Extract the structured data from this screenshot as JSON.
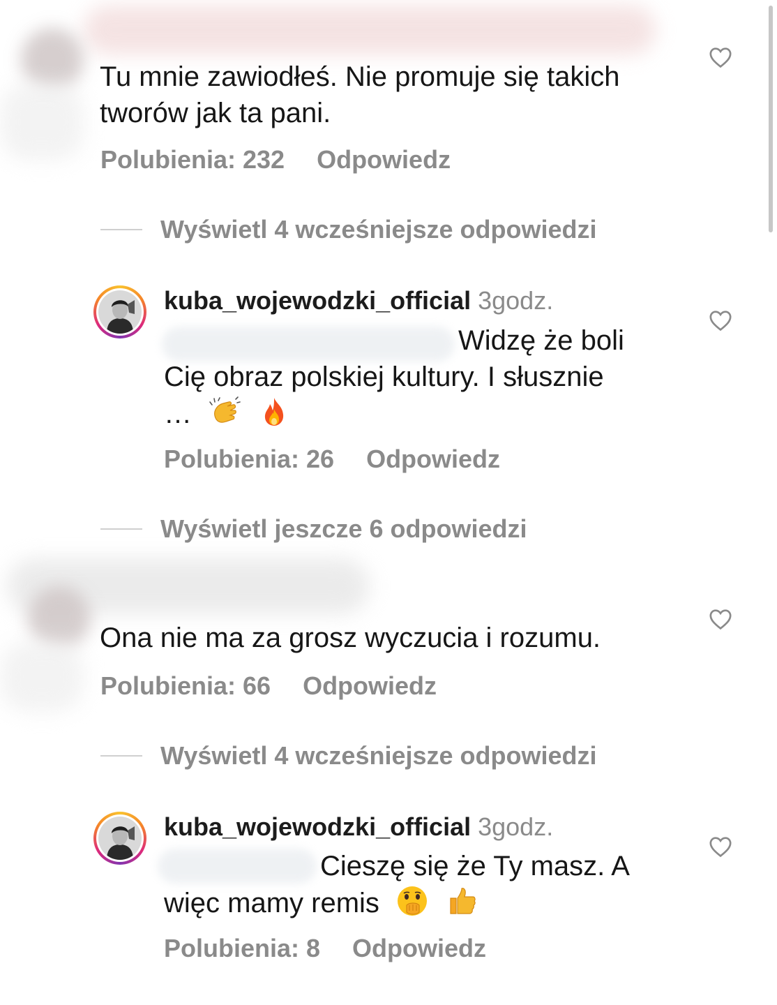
{
  "comments": [
    {
      "text": "Tu mnie zawiodłeś. Nie promuje się takich tworów jak ta pani.",
      "likes": "Polubienia: 232",
      "reply": "Odpowiedz",
      "view_replies": "Wyświetl 4 wcześniejsze odpowiedzi"
    },
    {
      "username": "kuba_wojewodzki_official",
      "time": "3godz.",
      "text_line1": "Widzę że boli",
      "text_line2": "Cię obraz polskiej kultury. I słusznie",
      "text_line3": "…",
      "emojis": [
        "clapping-hands-icon",
        "fire-icon"
      ],
      "likes": "Polubienia: 26",
      "reply": "Odpowiedz",
      "view_replies": "Wyświetl jeszcze 6 odpowiedzi"
    },
    {
      "text": "Ona nie ma za grosz wyczucia i rozumu.",
      "likes": "Polubienia: 66",
      "reply": "Odpowiedz",
      "view_replies": "Wyświetl 4 wcześniejsze odpowiedzi"
    },
    {
      "username": "kuba_wojewodzki_official",
      "time": "3godz.",
      "text_line1": "Cieszę się że Ty masz. A",
      "text_line2": "więc mamy remis",
      "emojis": [
        "face-with-hand-over-mouth-icon",
        "thumbs-up-icon"
      ],
      "likes": "Polubienia: 8",
      "reply": "Odpowiedz"
    }
  ],
  "colors": {
    "text": "#161616",
    "secondary": "#8a8a8a",
    "divider": "#cfcfcf"
  }
}
